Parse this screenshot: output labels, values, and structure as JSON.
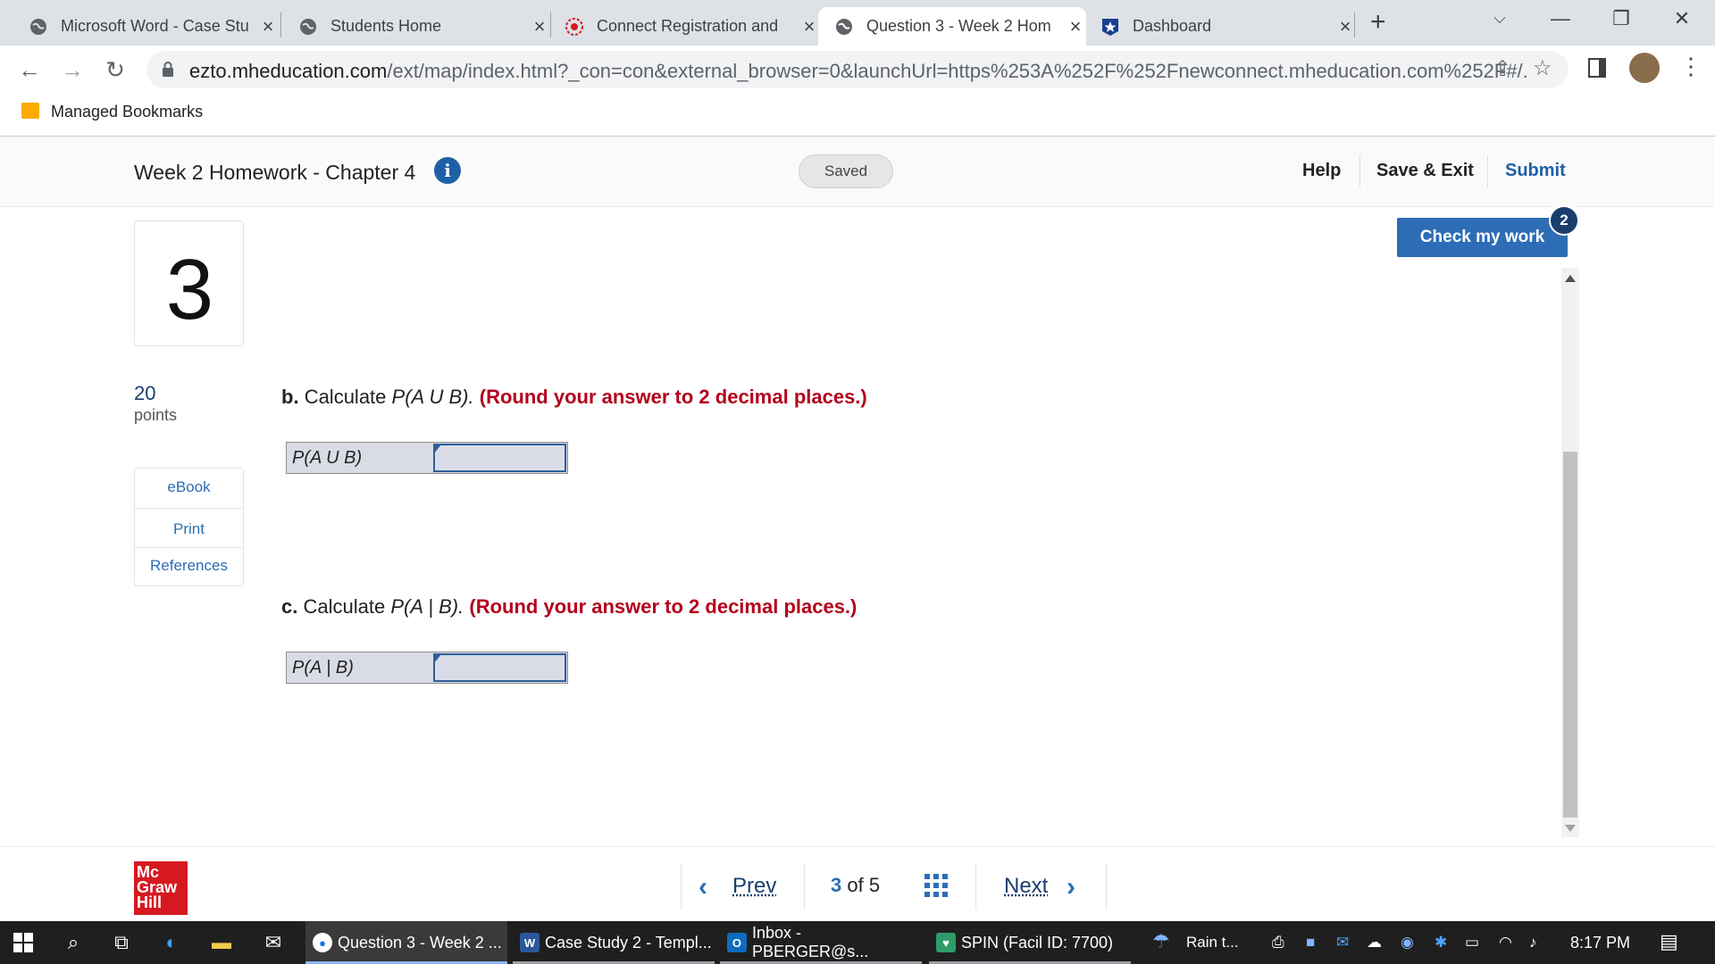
{
  "browser": {
    "tabs": [
      {
        "title": "Microsoft Word - Case Stu",
        "icon": "globe-icon",
        "active": false
      },
      {
        "title": "Students Home",
        "icon": "globe-icon",
        "active": false
      },
      {
        "title": "Connect Registration and",
        "icon": "connect-icon",
        "active": false
      },
      {
        "title": "Question 3 - Week 2 Hom",
        "icon": "globe-icon",
        "active": true
      },
      {
        "title": "Dashboard",
        "icon": "star-badge-icon",
        "active": false
      }
    ],
    "new_tab": "+",
    "url_main": "ezto.mheducation.com",
    "url_rest": "/ext/map/index.html?_con=con&external_browser=0&launchUrl=https%253A%252F%252Fnewconnect.mheducation.com%252F#/...",
    "bookmark": "Managed Bookmarks"
  },
  "header": {
    "assignment_title": "Week 2 Homework - Chapter 4",
    "save_status": "Saved",
    "help": "Help",
    "save_exit": "Save & Exit",
    "submit": "Submit"
  },
  "question": {
    "number": "3",
    "points_value": "20",
    "points_label": "points",
    "tools": [
      "eBook",
      "Print",
      "References"
    ],
    "check_button": "Check my work",
    "check_badge": "2",
    "part_b": {
      "letter": "b.",
      "text": "Calculate",
      "expr": "P(A U B).",
      "instruction": "(Round your answer to 2 decimal places.)",
      "input_label": "P(A U B)",
      "input_value": ""
    },
    "part_c": {
      "letter": "c.",
      "text": "Calculate",
      "expr": "P(A | B).",
      "instruction": "(Round your answer to 2 decimal places.)",
      "input_label": "P(A | B)",
      "input_value": ""
    }
  },
  "footer": {
    "logo_line1": "Mc",
    "logo_line2": "Graw",
    "logo_line3": "Hill",
    "prev": "Prev",
    "current": "3",
    "of": "of",
    "total": "5",
    "next": "Next"
  },
  "taskbar": {
    "apps": [
      {
        "label": "Question 3 - Week 2 ...",
        "icon": "chrome-icon"
      },
      {
        "label": "Case Study 2 - Templ...",
        "icon": "word-icon"
      },
      {
        "label": "Inbox - PBERGER@s...",
        "icon": "outlook-icon"
      },
      {
        "label": "SPIN  (Facil ID: 7700)",
        "icon": "spin-icon"
      }
    ],
    "weather": "Rain t...",
    "time": "8:17 PM"
  },
  "colors": {
    "accent_blue": "#2d6db5",
    "dark_blue": "#1a3e6e",
    "instruction_red": "#b3001b",
    "logo_red": "#d61921"
  }
}
